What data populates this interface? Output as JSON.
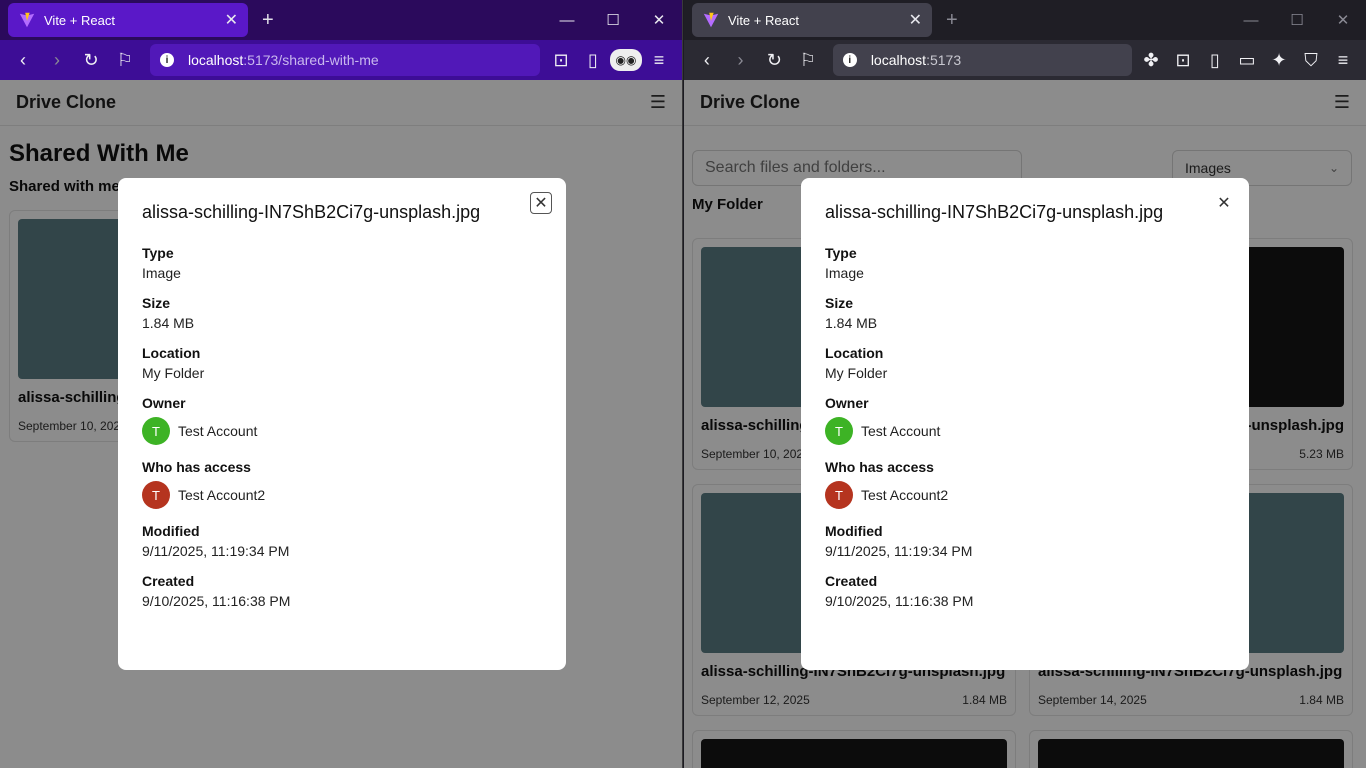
{
  "left": {
    "tab": {
      "title": "Vite + React"
    },
    "url": {
      "host": "localhost",
      "path": ":5173/shared-with-me"
    },
    "app": {
      "title": "Drive Clone",
      "page_title": "Shared With Me",
      "section_title": "Shared with me",
      "card": {
        "name": "alissa-schilling-IN7ShB2Ci7g-unsplash.jpg",
        "date": "September 10, 2025"
      }
    }
  },
  "right": {
    "tab": {
      "title": "Vite + React"
    },
    "url": {
      "host": "localhost",
      "path": ":5173"
    },
    "app": {
      "title": "Drive Clone",
      "search_placeholder": "Search files and folders...",
      "filter_value": "Images",
      "section_title": "My Folder",
      "cards": [
        {
          "name": "alissa-schilling-IN7ShB2Ci7g-unsplash.jpg",
          "date": "September 10, 2025",
          "size": "",
          "thumb": "teal"
        },
        {
          "name": "alissa-schilling-IN7ShB2Ci7g-unsplash.jpg",
          "date": "",
          "size": "5.23 MB",
          "thumb": "dark"
        },
        {
          "name": "alissa-schilling-IN7ShB2Ci7g-unsplash.jpg",
          "date": "September 12, 2025",
          "size": "1.84 MB",
          "thumb": "teal"
        },
        {
          "name": "alissa-schilling-IN7ShB2Ci7g-unsplash.jpg",
          "date": "September 14, 2025",
          "size": "1.84 MB",
          "thumb": "teal"
        }
      ]
    }
  },
  "modal": {
    "title": "alissa-schilling-IN7ShB2Ci7g-unsplash.jpg",
    "type_label": "Type",
    "type_value": "Image",
    "size_label": "Size",
    "size_value": "1.84 MB",
    "location_label": "Location",
    "location_value": "My Folder",
    "owner_label": "Owner",
    "owner_initial": "T",
    "owner_name": "Test Account",
    "access_label": "Who has access",
    "access_initial": "T",
    "access_name": "Test Account2",
    "modified_label": "Modified",
    "modified_value": "9/11/2025, 11:19:34 PM",
    "created_label": "Created",
    "created_value": "9/10/2025, 11:16:38 PM"
  },
  "colors": {
    "left_tabstrip": "#2b0a5c",
    "left_navbar": "#3d0d96",
    "right_tabstrip": "#1f1e25",
    "right_navbar": "#2b2a33",
    "owner_avatar": "#3db325",
    "access_avatar": "#b5341f"
  }
}
